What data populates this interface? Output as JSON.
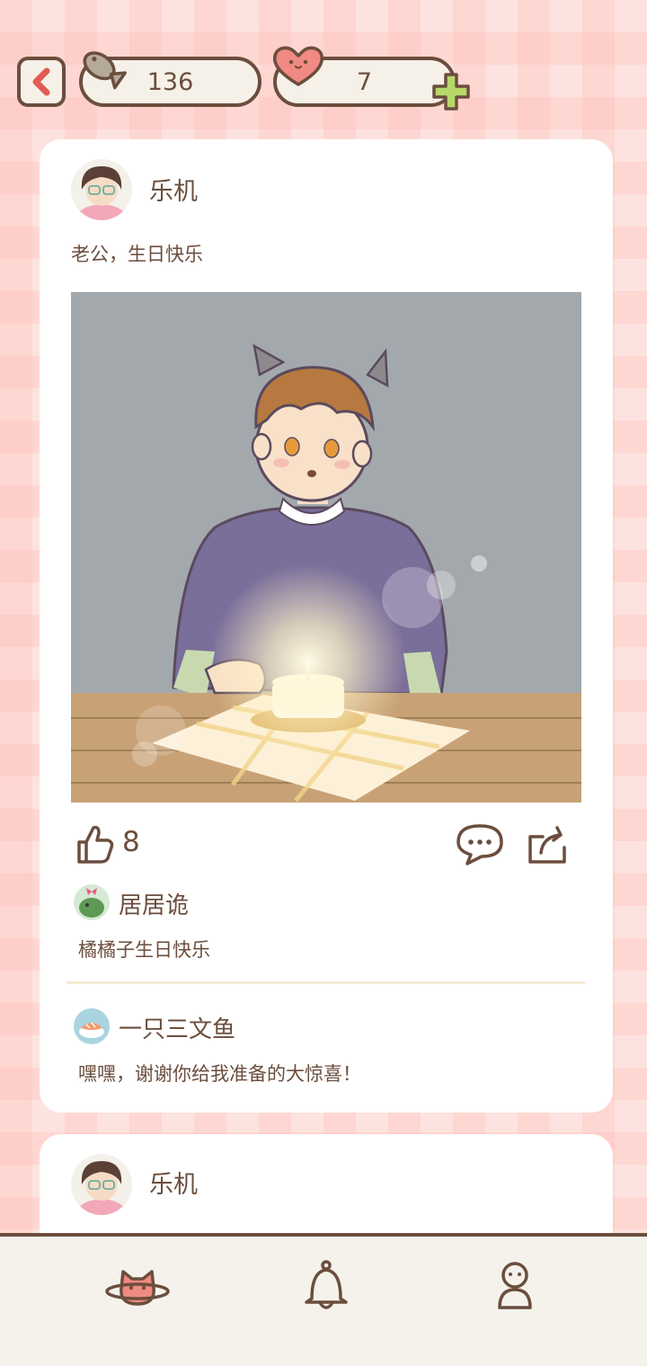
{
  "topbar": {
    "fish_count": "136",
    "heart_count": "7"
  },
  "post": {
    "author": "乐机",
    "text": "老公，生日快乐",
    "like_count": "8",
    "comments": [
      {
        "name": "居居诡",
        "text": "橘橘子生日快乐"
      },
      {
        "name": "一只三文鱼",
        "text": "嘿嘿，谢谢你给我准备的大惊喜！"
      }
    ]
  },
  "next_post": {
    "author": "乐机"
  },
  "nav": {
    "items": [
      "planet-cat-icon",
      "bell-icon",
      "profile-icon"
    ]
  },
  "colors": {
    "outline": "#6b4e3d",
    "background": "#fde3df",
    "card": "#ffffff",
    "accent_green": "#b6d86a",
    "accent_pink": "#f08a82"
  }
}
